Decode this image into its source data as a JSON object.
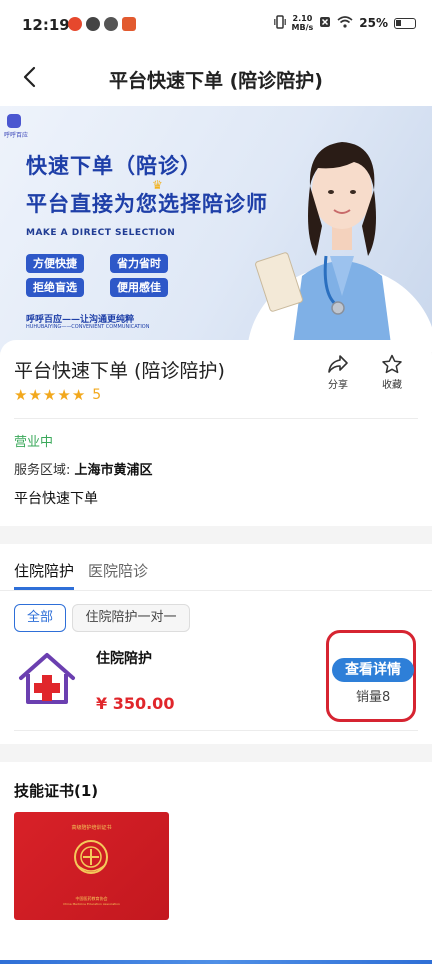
{
  "status_bar": {
    "time": "12:19",
    "net_speed_value": "2.10",
    "net_speed_unit": "MB/s",
    "battery": "25%"
  },
  "header": {
    "title": "平台快速下单 (陪诊陪护)"
  },
  "banner": {
    "logo_text": "呼呼百应",
    "headline_1": "快速下单（陪诊）",
    "headline_2": "平台直接为您选择陪诊师",
    "english": "MAKE A DIRECT SELECTION",
    "tags": [
      "方便快捷",
      "省力省时",
      "拒绝盲选",
      "便用感佳"
    ],
    "slogan": "呼呼百应——让沟通更纯粹",
    "slogan_en": "HUHUBAIYING——CONVENIENT COMMUNICATION"
  },
  "info": {
    "name": "平台快速下单 (陪诊陪护)",
    "rating": "5",
    "stars": 5,
    "share_label": "分享",
    "favorite_label": "收藏",
    "open_status": "营业中",
    "area_label": "服务区域:",
    "area_value": "上海市黄浦区",
    "description": "平台快速下单"
  },
  "services": {
    "tabs": [
      {
        "label": "住院陪护",
        "active": true
      },
      {
        "label": "医院陪诊",
        "active": false
      }
    ],
    "chips": [
      {
        "label": "全部",
        "active": true
      },
      {
        "label": "住院陪护一对一",
        "active": false
      }
    ],
    "item": {
      "name": "住院陪护",
      "price": "¥ 350.00",
      "detail_button": "查看详情",
      "sales": "销量8"
    }
  },
  "certificates": {
    "title": "技能证书(1)",
    "book_title": "高级陪护培训证书",
    "book_footer": "中国医药教育协会",
    "book_footer_en": "China Medicine Education Association"
  },
  "colors": {
    "accent": "#2e7fd8",
    "price": "#e0262b",
    "open": "#3aa85a",
    "star": "#f2a81d",
    "highlight": "#d62431"
  }
}
